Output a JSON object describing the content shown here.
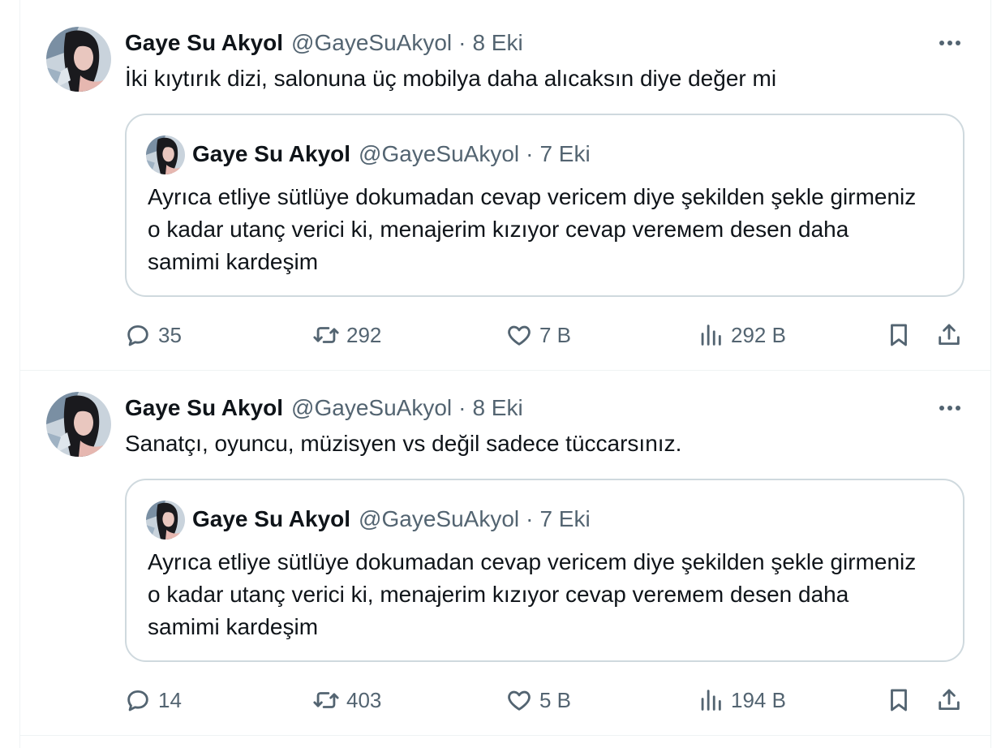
{
  "tweets": [
    {
      "name": "Gaye Su Akyol",
      "handle": "@GayeSuAkyol",
      "separator": "·",
      "date": "8 Eki",
      "text": "İki kıytırık dizi, salonuna üç mobilya daha alıcaksın diye değer mi",
      "quote": {
        "name": "Gaye Su Akyol",
        "handle": "@GayeSuAkyol",
        "separator": "·",
        "date": "7 Eki",
        "text": "Ayrıca etliye sütlüye dokumadan cevap vericem diye şekilden şekle girmeniz o kadar utanç verici ki, menajerim kızıyor cevap verемem desen daha samimi kardeşim"
      },
      "replies": "35",
      "retweets": "292",
      "likes": "7 B",
      "views": "292 B"
    },
    {
      "name": "Gaye Su Akyol",
      "handle": "@GayeSuAkyol",
      "separator": "·",
      "date": "8 Eki",
      "text": "Sanatçı, oyuncu, müzisyen vs değil sadece tüccarsınız.",
      "quote": {
        "name": "Gaye Su Akyol",
        "handle": "@GayeSuAkyol",
        "separator": "·",
        "date": "7 Eki",
        "text": "Ayrıca etliye sütlüye dokumadan cevap vericem diye şekilden şekle girmeniz o kadar utanç verici ki, menajerim kızıyor cevap verемem desen daha samimi kardeşim"
      },
      "replies": "14",
      "retweets": "403",
      "likes": "5 B",
      "views": "194 B"
    }
  ],
  "icons": {
    "reply": "reply-icon",
    "retweet": "retweet-icon",
    "like": "heart-icon",
    "views": "views-chart-icon",
    "bookmark": "bookmark-icon",
    "share": "share-icon",
    "more": "more-dots-icon"
  },
  "colors": {
    "text": "#0f1419",
    "secondary": "#536471",
    "border": "#cfd9de",
    "divider": "#eff3f4"
  }
}
